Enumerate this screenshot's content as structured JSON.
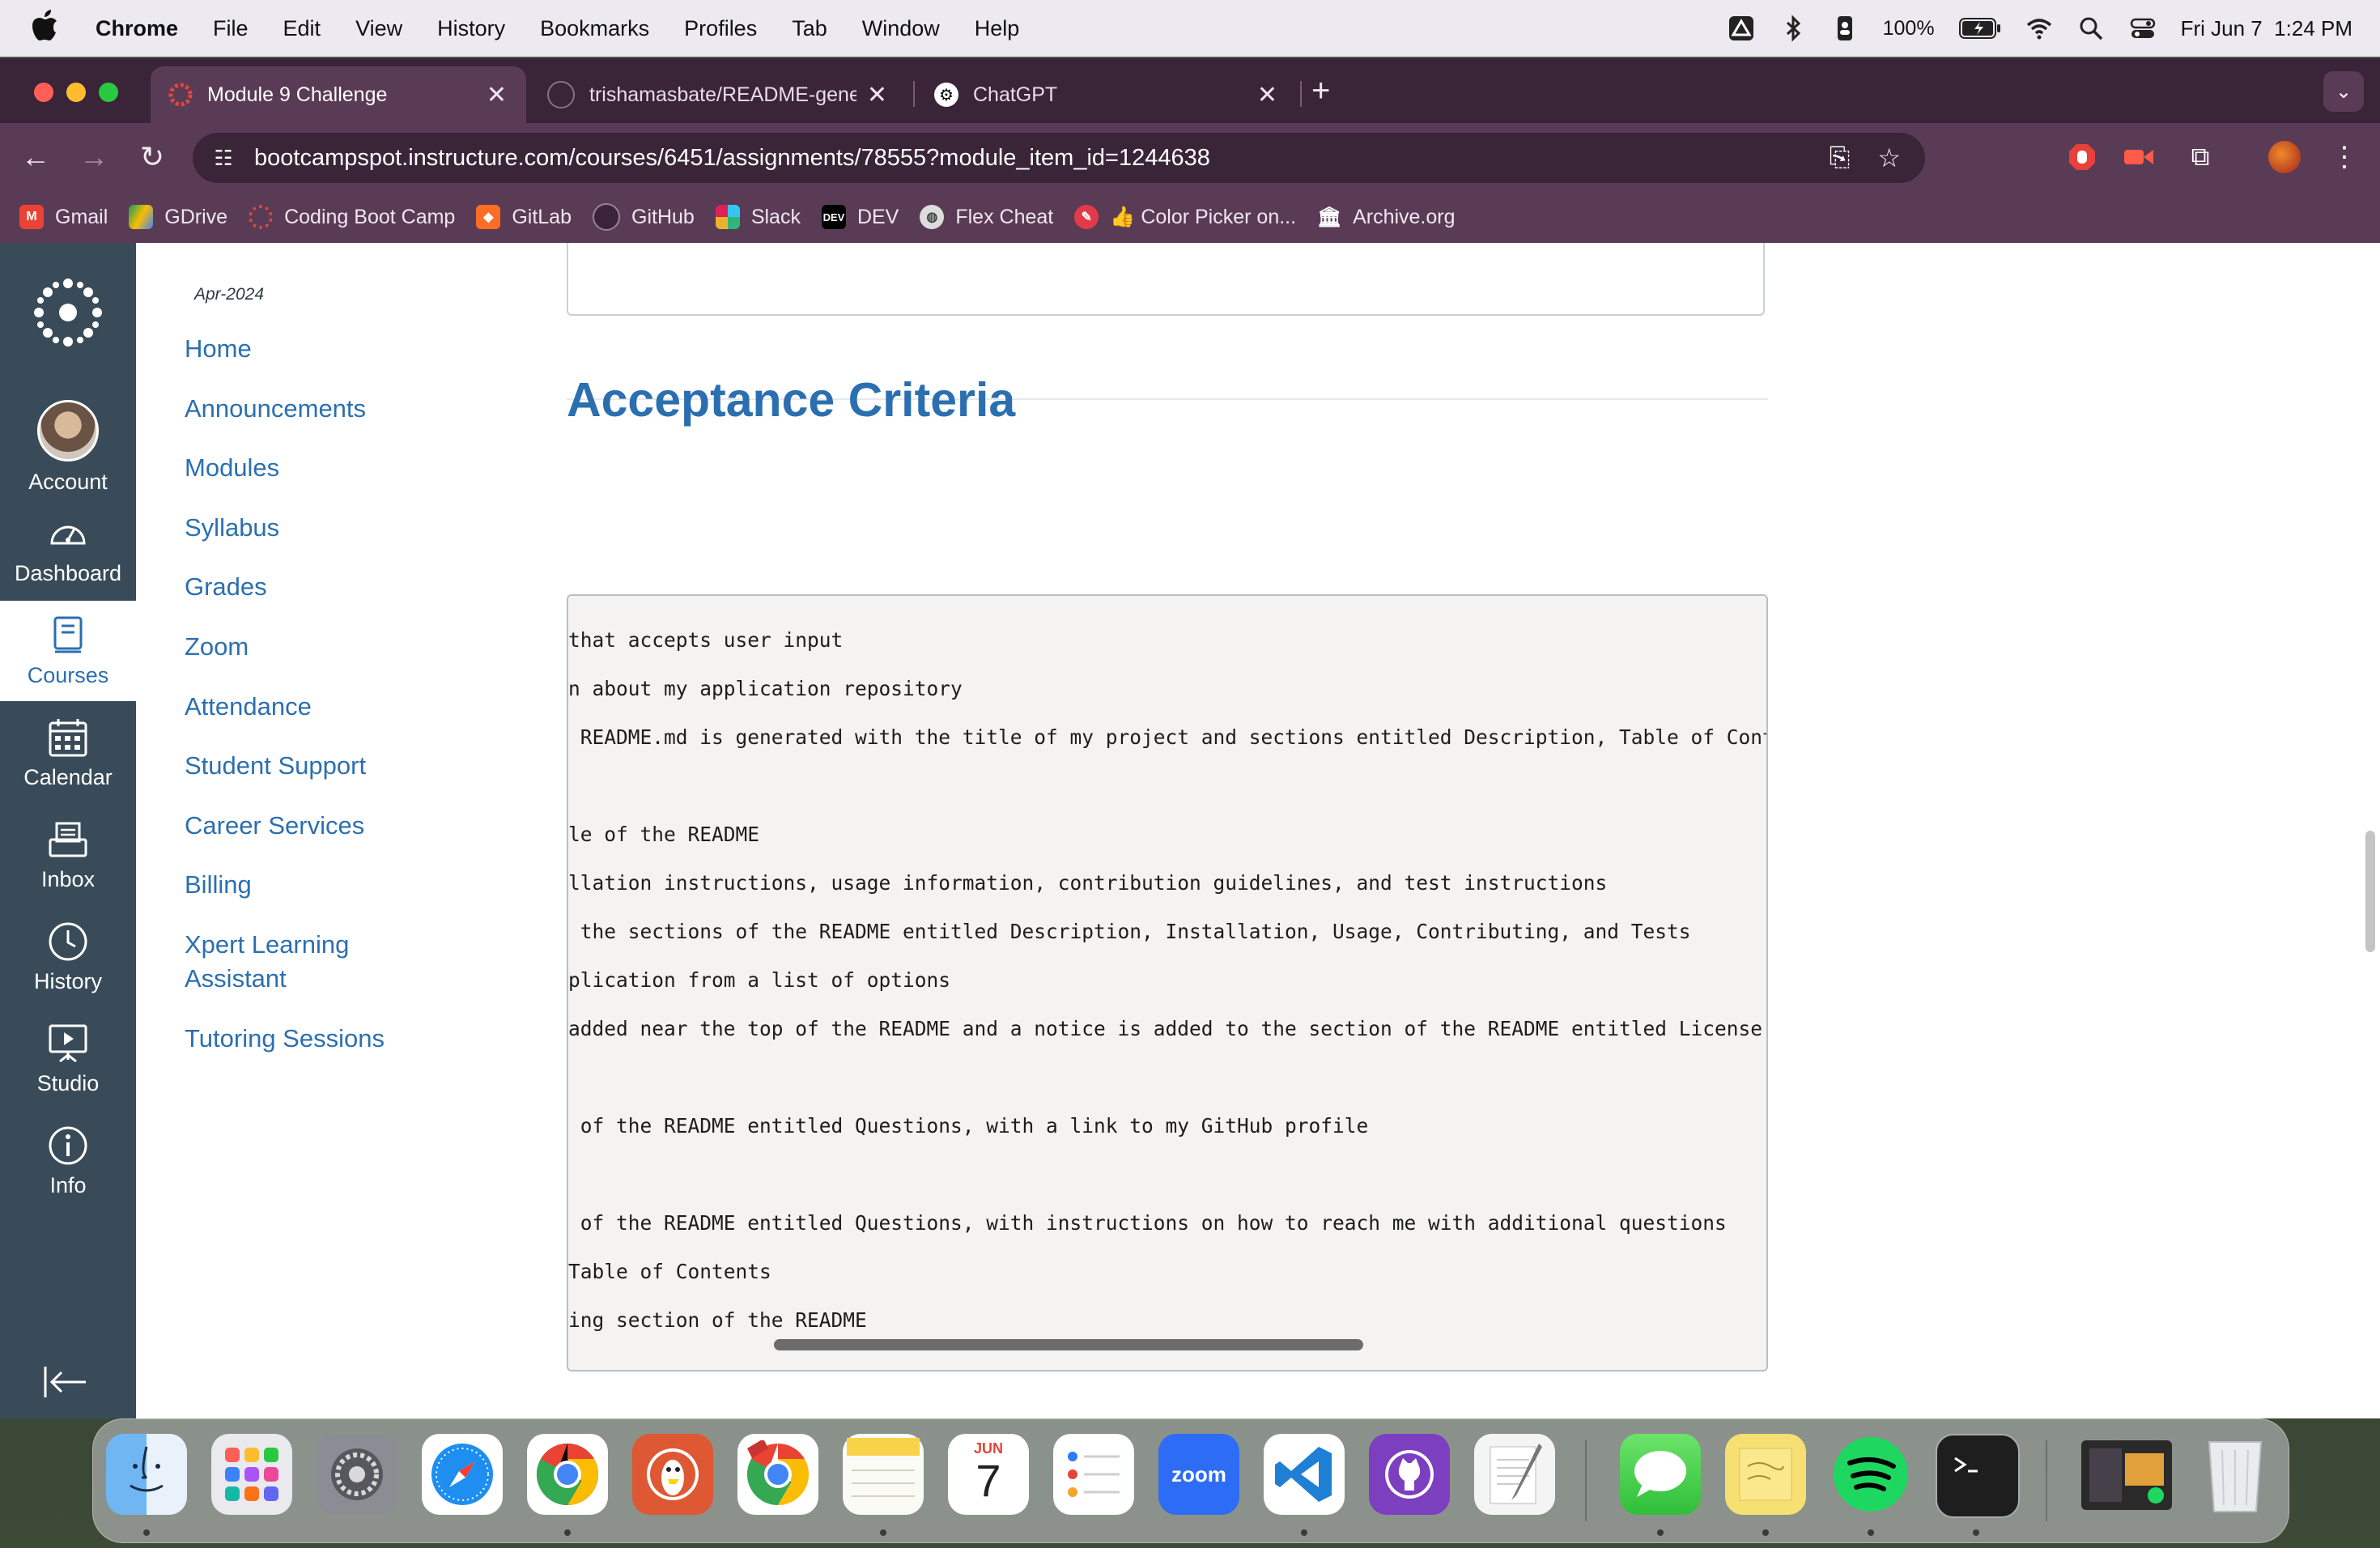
{
  "menubar": {
    "app": "Chrome",
    "items": [
      "File",
      "Edit",
      "View",
      "History",
      "Bookmarks",
      "Profiles",
      "Tab",
      "Window",
      "Help"
    ],
    "battery": "100%",
    "datetime": "Fri Jun 7  1:24 PM"
  },
  "tabs": [
    {
      "title": "Module 9 Challenge",
      "active": true
    },
    {
      "title": "trishamasbate/README-gene",
      "active": false
    },
    {
      "title": "ChatGPT",
      "active": false
    }
  ],
  "address": {
    "url": "bootcampspot.instructure.com/courses/6451/assignments/78555?module_item_id=1244638"
  },
  "bookmarks": [
    "Gmail",
    "GDrive",
    "Coding Boot Camp",
    "GitLab",
    "GitHub",
    "Slack",
    "DEV",
    "Flex Cheat",
    "👍 Color Picker on...",
    "Archive.org"
  ],
  "global_nav": [
    {
      "label": "Account",
      "icon": "avatar"
    },
    {
      "label": "Dashboard",
      "icon": "dashboard-icon"
    },
    {
      "label": "Courses",
      "icon": "courses-icon",
      "active": true
    },
    {
      "label": "Calendar",
      "icon": "calendar-icon"
    },
    {
      "label": "Inbox",
      "icon": "inbox-icon"
    },
    {
      "label": "History",
      "icon": "history-icon"
    },
    {
      "label": "Studio",
      "icon": "studio-icon"
    },
    {
      "label": "Info",
      "icon": "info-icon"
    }
  ],
  "course_nav": {
    "term": "Apr-2024",
    "links": [
      "Home",
      "Announcements",
      "Modules",
      "Syllabus",
      "Grades",
      "Zoom",
      "Attendance",
      "Student Support",
      "Career Services",
      "Billing",
      "Xpert Learning Assistant",
      "Tutoring Sessions"
    ]
  },
  "content": {
    "heading": "Acceptance Criteria",
    "code_lines": [
      "that accepts user input",
      "n about my application repository",
      " README.md is generated with the title of my project and sections entitled Description, Table of Conten",
      "",
      "le of the README",
      "llation instructions, usage information, contribution guidelines, and test instructions",
      " the sections of the README entitled Description, Installation, Usage, Contributing, and Tests",
      "plication from a list of options",
      "added near the top of the README and a notice is added to the section of the README entitled License th",
      "",
      " of the README entitled Questions, with a link to my GitHub profile",
      "",
      " of the README entitled Questions, with instructions on how to reach me with additional questions",
      "Table of Contents",
      "ing section of the README"
    ]
  },
  "dock": {
    "calendar_month": "JUN",
    "calendar_day": "7",
    "apps": [
      "finder",
      "launchpad",
      "system-settings",
      "safari",
      "chrome",
      "duckduckgo",
      "chrome-dev",
      "notes",
      "calendar",
      "reminders",
      "zoom",
      "vscode",
      "github-desktop",
      "textedit",
      "messages",
      "stickies",
      "spotify",
      "terminal",
      "screenshot-preview",
      "trash"
    ],
    "zoom_label": "zoom"
  },
  "colors": {
    "canvas_nav": "#394b58",
    "link_blue": "#2b6fb0",
    "chrome_frame": "#5a3b55",
    "chrome_tabstrip": "#3a2438"
  }
}
